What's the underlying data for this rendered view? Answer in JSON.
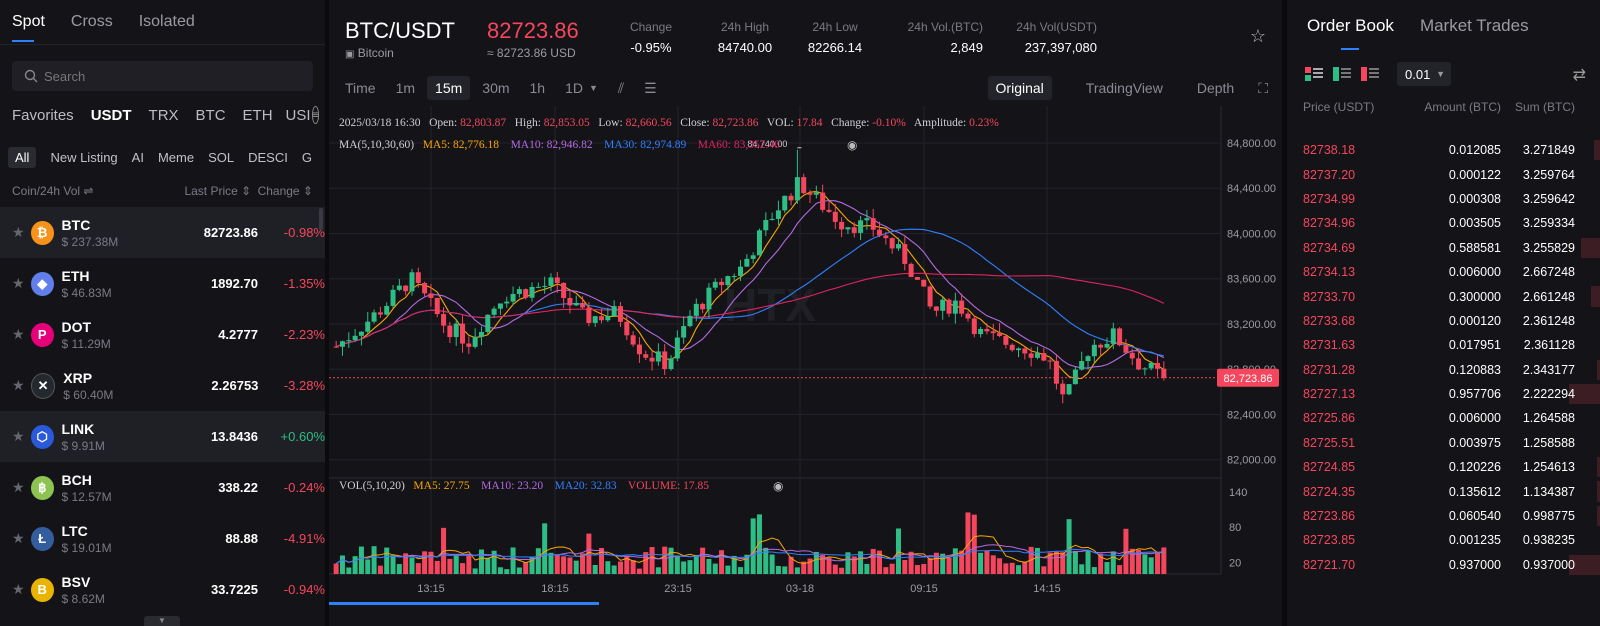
{
  "left": {
    "tabs": [
      "Spot",
      "Cross",
      "Isolated"
    ],
    "search_placeholder": "Search",
    "categories": [
      "Favorites",
      "USDT",
      "TRX",
      "BTC",
      "ETH",
      "USI"
    ],
    "filters": [
      "All",
      "New Listing",
      "AI",
      "Meme",
      "SOL",
      "DESCI",
      "G"
    ],
    "col_headers": {
      "coin": "Coin/24h Vol ⇌",
      "price": "Last Price ⇕",
      "change": "Change ⇕"
    },
    "coins": [
      {
        "symbol": "BTC",
        "vol": "$ 237.38M",
        "price": "82723.86",
        "change": "-0.98%",
        "dir": "down",
        "color": "#f7931a",
        "glyph": "₿"
      },
      {
        "symbol": "ETH",
        "vol": "$ 46.83M",
        "price": "1892.70",
        "change": "-1.35%",
        "dir": "down",
        "color": "#627eea",
        "glyph": "◆"
      },
      {
        "symbol": "DOT",
        "vol": "$ 11.29M",
        "price": "4.2777",
        "change": "-2.23%",
        "dir": "down",
        "color": "#e6007a",
        "glyph": "P"
      },
      {
        "symbol": "XRP",
        "vol": "$ 60.40M",
        "price": "2.26753",
        "change": "-3.28%",
        "dir": "down",
        "color": "#23292f",
        "glyph": "✕"
      },
      {
        "symbol": "LINK",
        "vol": "$ 9.91M",
        "price": "13.8436",
        "change": "+0.60%",
        "dir": "up",
        "color": "#2a5ada",
        "glyph": "⬡"
      },
      {
        "symbol": "BCH",
        "vol": "$ 12.57M",
        "price": "338.22",
        "change": "-0.24%",
        "dir": "down",
        "color": "#8dc351",
        "glyph": "฿"
      },
      {
        "symbol": "LTC",
        "vol": "$ 19.01M",
        "price": "88.88",
        "change": "-4.91%",
        "dir": "down",
        "color": "#345d9d",
        "glyph": "Ł"
      },
      {
        "symbol": "BSV",
        "vol": "$ 8.62M",
        "price": "33.7225",
        "change": "-0.94%",
        "dir": "down",
        "color": "#eab300",
        "glyph": "B"
      }
    ]
  },
  "ticker": {
    "pair": "BTC/USDT",
    "name": "Bitcoin",
    "price": "82723.86",
    "price_usd": "≈ 82723.86 USD",
    "stats": [
      {
        "label": "Change",
        "value": "-0.95%",
        "dir": "down"
      },
      {
        "label": "24h High",
        "value": "84740.00",
        "dir": "none"
      },
      {
        "label": "24h Low",
        "value": "82266.14",
        "dir": "none"
      },
      {
        "label": "24h Vol.(BTC)",
        "value": "2,849",
        "dir": "none"
      },
      {
        "label": "24h Vol(USDT)",
        "value": "237,397,080",
        "dir": "none"
      }
    ]
  },
  "toolbar": {
    "intervals": [
      "Time",
      "1m",
      "15m",
      "30m",
      "1h",
      "1D"
    ],
    "active_interval": "15m",
    "views": [
      "Original",
      "TradingView",
      "Depth"
    ]
  },
  "chart_data": {
    "type": "candlestick",
    "info_line": {
      "date": "2025/03/18 16:30",
      "open_label": "Open:",
      "open": "82,803.87",
      "high_label": "High:",
      "high": "82,853.05",
      "low_label": "Low:",
      "low": "82,660.56",
      "close_label": "Close:",
      "close": "82,723.86",
      "vol_label": "VOL:",
      "vol": "17.84",
      "change_label": "Change:",
      "change": "-0.10%",
      "amp_label": "Amplitude:",
      "amp": "0.23%"
    },
    "ma_line": {
      "label": "MA(5,10,30,60)",
      "items": [
        {
          "text": "MA5: 82,776.18",
          "color": "#f7a600"
        },
        {
          "text": "MA10: 82,946.82",
          "color": "#b36ae2"
        },
        {
          "text": "MA30: 82,974.89",
          "color": "#2f80ff"
        },
        {
          "text": "MA60: 83,352.40",
          "color": "#e0245e"
        }
      ]
    },
    "y_ticks": [
      "84,800.00",
      "84,400.00",
      "84,000.00",
      "83,600.00",
      "83,200.00",
      "82,800.00",
      "82,400.00",
      "82,000.00"
    ],
    "y_values": [
      84800,
      84400,
      84000,
      83600,
      83200,
      82800,
      82400,
      82000
    ],
    "ylim": [
      81900,
      84950
    ],
    "x_ticks": [
      "13:15",
      "18:15",
      "23:15",
      "03-18",
      "09:15",
      "14:15"
    ],
    "max_label": "84,740.00",
    "last_price_label": "82,723.86",
    "last_price": 82723.86,
    "watermark": "HTX",
    "vol_line": {
      "label": "VOL(5,10,20)",
      "items": [
        {
          "text": "MA5: 27.75",
          "color": "#f7a600"
        },
        {
          "text": "MA10: 23.20",
          "color": "#b36ae2"
        },
        {
          "text": "MA20: 32.83",
          "color": "#2f80ff"
        },
        {
          "text": "VOLUME: 17.85",
          "color": "#f6465d"
        }
      ]
    },
    "vol_ticks": [
      "140",
      "80",
      "20"
    ],
    "vol_tick_values": [
      140,
      80,
      20
    ],
    "vol_lim": [
      0,
      150
    ],
    "colors": {
      "up": "#2ebd85",
      "down": "#f6465d"
    }
  },
  "orderbook": {
    "tabs": [
      "Order Book",
      "Market Trades"
    ],
    "precision": "0.01",
    "headers": [
      "Price (USDT)",
      "Amount (BTC)",
      "Sum (BTC)"
    ],
    "rows": [
      {
        "price": "82738.18",
        "amount": "0.012085",
        "sum": "3.271849",
        "depth": 0.02
      },
      {
        "price": "82737.20",
        "amount": "0.000122",
        "sum": "3.259764",
        "depth": 0.0
      },
      {
        "price": "82734.99",
        "amount": "0.000308",
        "sum": "3.259642",
        "depth": 0.0
      },
      {
        "price": "82734.96",
        "amount": "0.003505",
        "sum": "3.259334",
        "depth": 0.0
      },
      {
        "price": "82734.69",
        "amount": "0.588581",
        "sum": "3.255829",
        "depth": 0.06
      },
      {
        "price": "82734.13",
        "amount": "0.006000",
        "sum": "2.667248",
        "depth": 0.0
      },
      {
        "price": "82733.70",
        "amount": "0.300000",
        "sum": "2.661248",
        "depth": 0.03
      },
      {
        "price": "82733.68",
        "amount": "0.000120",
        "sum": "2.361248",
        "depth": 0.0
      },
      {
        "price": "82731.63",
        "amount": "0.017951",
        "sum": "2.361128",
        "depth": 0.0
      },
      {
        "price": "82731.28",
        "amount": "0.120883",
        "sum": "2.343177",
        "depth": 0.01
      },
      {
        "price": "82727.13",
        "amount": "0.957706",
        "sum": "2.222294",
        "depth": 0.1
      },
      {
        "price": "82725.86",
        "amount": "0.006000",
        "sum": "1.264588",
        "depth": 0.0
      },
      {
        "price": "82725.51",
        "amount": "0.003975",
        "sum": "1.258588",
        "depth": 0.0
      },
      {
        "price": "82724.85",
        "amount": "0.120226",
        "sum": "1.254613",
        "depth": 0.01
      },
      {
        "price": "82724.35",
        "amount": "0.135612",
        "sum": "1.134387",
        "depth": 0.01
      },
      {
        "price": "82723.86",
        "amount": "0.060540",
        "sum": "0.998775",
        "depth": 0.01
      },
      {
        "price": "82723.85",
        "amount": "0.001235",
        "sum": "0.938235",
        "depth": 0.0
      },
      {
        "price": "82721.70",
        "amount": "0.937000",
        "sum": "0.937000",
        "depth": 0.1
      }
    ]
  }
}
